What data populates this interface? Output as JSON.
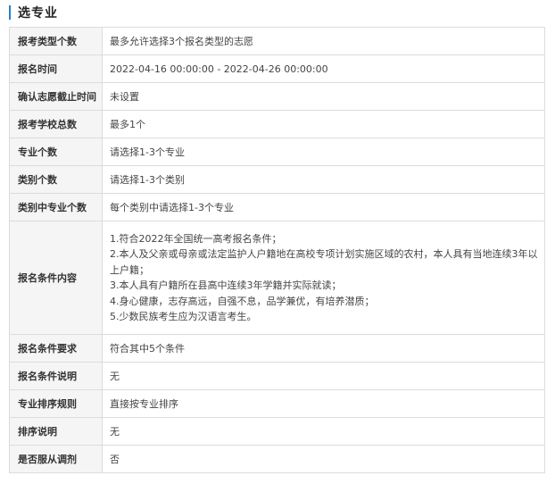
{
  "section": {
    "title": "选专业"
  },
  "rows": [
    {
      "label": "报考类型个数",
      "value": "最多允许选择3个报名类型的志愿"
    },
    {
      "label": "报名时间",
      "value": "2022-04-16 00:00:00 - 2022-04-26 00:00:00"
    },
    {
      "label": "确认志愿截止时间",
      "value": "未设置"
    },
    {
      "label": "报考学校总数",
      "value": "最多1个"
    },
    {
      "label": "专业个数",
      "value": "请选择1-3个专业"
    },
    {
      "label": "类别个数",
      "value": "请选择1-3个类别"
    },
    {
      "label": "类别中专业个数",
      "value": "每个类别中请选择1-3个专业"
    },
    {
      "label": "报名条件内容",
      "lines": [
        "1.符合2022年全国统一高考报名条件；",
        "2.本人及父亲或母亲或法定监护人户籍地在高校专项计划实施区域的农村，本人具有当地连续3年以上户籍；",
        "3.本人具有户籍所在县高中连续3年学籍并实际就读；",
        "4.身心健康，志存高远，自强不息，品学兼优，有培养潜质；",
        "5.少数民族考生应为汉语言考生。"
      ]
    },
    {
      "label": "报名条件要求",
      "value": "符合其中5个条件"
    },
    {
      "label": "报名条件说明",
      "value": "无"
    },
    {
      "label": "专业排序规则",
      "value": "直接按专业排序"
    },
    {
      "label": "排序说明",
      "value": "无"
    },
    {
      "label": "是否服从调剂",
      "value": "否"
    }
  ]
}
